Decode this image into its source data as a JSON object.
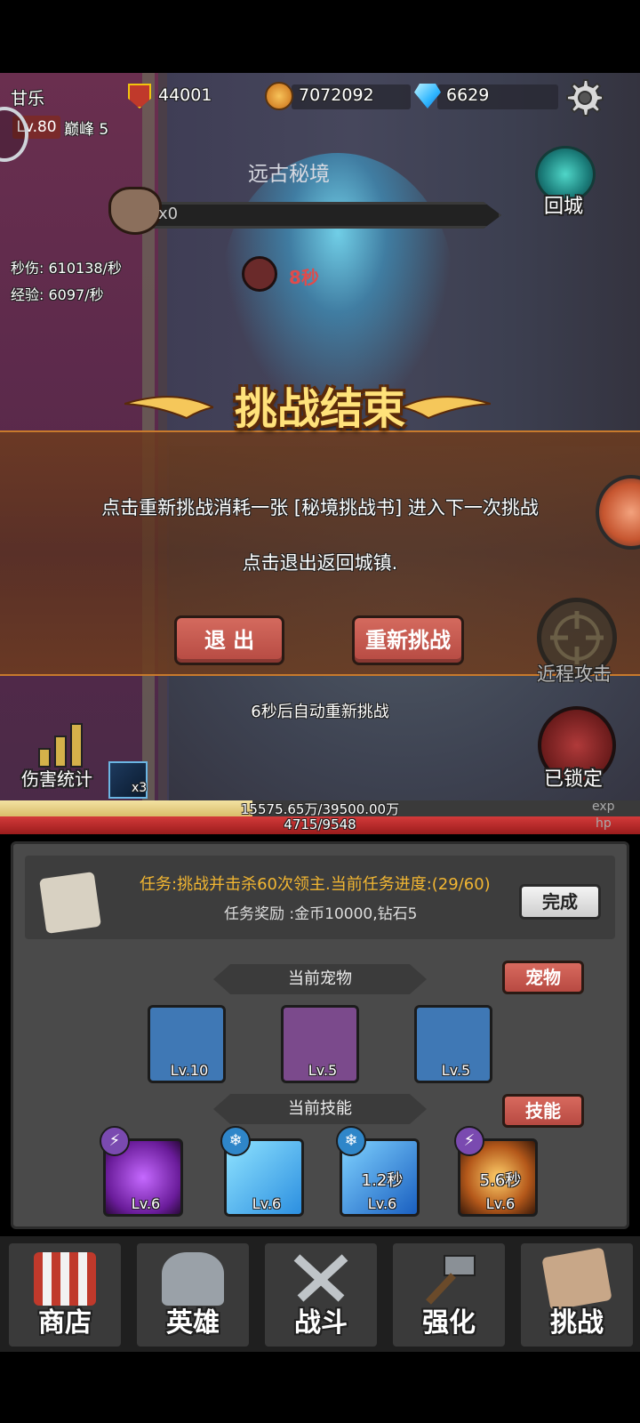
{
  "hud": {
    "player_name": "甘乐",
    "power": "44001",
    "gold": "7072092",
    "gems": "6629",
    "level": "Lv.80",
    "peak": "巅峰 5"
  },
  "scene": {
    "area_title": "远古秘境",
    "return_label": "回城",
    "boss_count": "x0",
    "dps": "秒伤: 610138/秒",
    "exp_rate": "经验: 6097/秒",
    "timer": "8秒",
    "melee_label": "近程攻击",
    "lock_label": "已锁定",
    "damage_stats_label": "伤害统计",
    "ice_buff_count": "x3"
  },
  "result": {
    "title": "挑战结束",
    "line1": "点击重新挑战消耗一张 [秘境挑战书] 进入下一次挑战",
    "line2": "点击退出返回城镇.",
    "exit_label": "退  出",
    "retry_label": "重新挑战",
    "auto_retry": "6秒后自动重新挑战"
  },
  "bars": {
    "exp_text": "15575.65万/39500.00万",
    "exp_label": "exp",
    "exp_fraction": 0.394,
    "hp_text": "4715/9548",
    "hp_label": "hp"
  },
  "quest": {
    "title": "任务:挑战并击杀60次领主.当前任务进度:(29/60)",
    "reward": "任务奖励 :金币10000,钻石5",
    "complete_label": "完成"
  },
  "pets": {
    "header": "当前宠物",
    "button_label": "宠物",
    "items": [
      {
        "level": "Lv.10",
        "icon": "raccoon-pet-icon"
      },
      {
        "level": "Lv.5",
        "icon": "owl-pet-icon"
      },
      {
        "level": "Lv.5",
        "icon": "bear-pet-icon"
      }
    ]
  },
  "skills": {
    "header": "当前技能",
    "button_label": "技能",
    "items": [
      {
        "level": "Lv.6",
        "cooldown": "",
        "type": "lightning"
      },
      {
        "level": "Lv.6",
        "cooldown": "",
        "type": "ice"
      },
      {
        "level": "Lv.6",
        "cooldown": "1.2秒",
        "type": "ice"
      },
      {
        "level": "Lv.6",
        "cooldown": "5.6秒",
        "type": "lightning"
      }
    ]
  },
  "nav": {
    "shop": "商店",
    "hero": "英雄",
    "battle": "战斗",
    "upgrade": "强化",
    "challenge": "挑战"
  },
  "colors": {
    "accent_gold": "#ffe27a",
    "quest_orange": "#f2b632",
    "button_red": "#b84a42",
    "hp_red": "#d33a3a"
  }
}
